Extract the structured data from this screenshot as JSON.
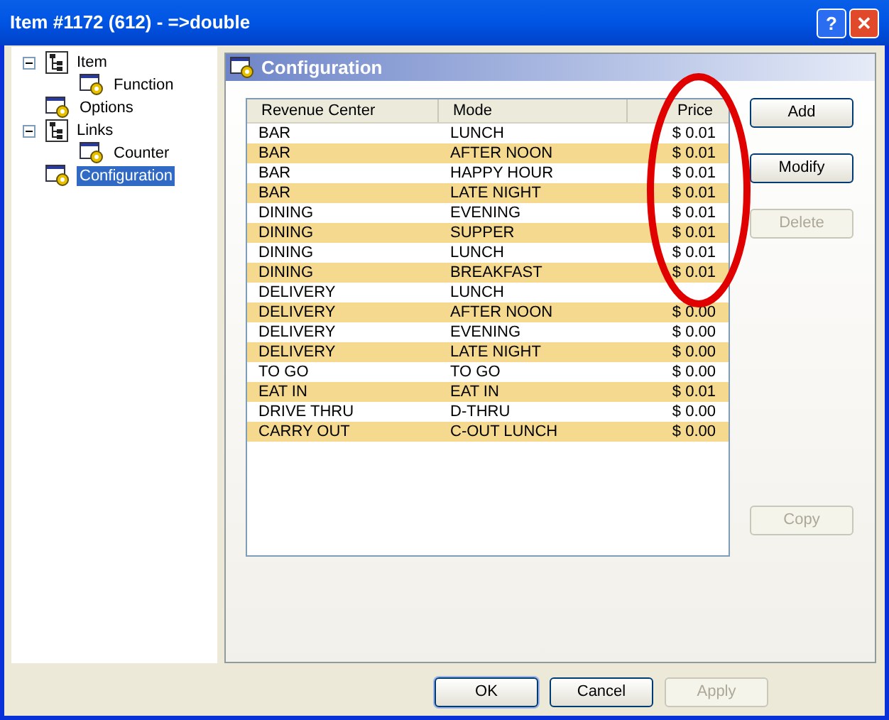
{
  "window": {
    "title": "Item #1172 (612) - =>double"
  },
  "title_buttons": [
    {
      "kind": "help",
      "label": "?"
    },
    {
      "kind": "close",
      "label": "✕"
    }
  ],
  "tree": [
    {
      "label": "Item",
      "kind": "group",
      "expanded": true,
      "selected": false,
      "children": [
        {
          "label": "Function",
          "kind": "page",
          "selected": false
        }
      ]
    },
    {
      "label": "Options",
      "kind": "page",
      "selected": false
    },
    {
      "label": "Links",
      "kind": "group",
      "expanded": true,
      "selected": false,
      "children": [
        {
          "label": "Counter",
          "kind": "page",
          "selected": false
        }
      ]
    },
    {
      "label": "Configuration",
      "kind": "page",
      "selected": true
    }
  ],
  "panel": {
    "title": "Configuration"
  },
  "table": {
    "columns": [
      "Revenue Center",
      "Mode",
      "Price"
    ],
    "rows": [
      {
        "cells": [
          "BAR",
          "LUNCH",
          "$ 0.01"
        ],
        "highlighted": false
      },
      {
        "cells": [
          "BAR",
          "AFTER NOON",
          "$ 0.01"
        ],
        "highlighted": true
      },
      {
        "cells": [
          "BAR",
          "HAPPY HOUR",
          "$ 0.01"
        ],
        "highlighted": false
      },
      {
        "cells": [
          "BAR",
          "LATE NIGHT",
          "$ 0.01"
        ],
        "highlighted": true
      },
      {
        "cells": [
          "DINING",
          "EVENING",
          "$ 0.01"
        ],
        "highlighted": false
      },
      {
        "cells": [
          "DINING",
          "SUPPER",
          "$ 0.01"
        ],
        "highlighted": true
      },
      {
        "cells": [
          "DINING",
          "LUNCH",
          "$ 0.01"
        ],
        "highlighted": false
      },
      {
        "cells": [
          "DINING",
          "BREAKFAST",
          "$ 0.01"
        ],
        "highlighted": true
      },
      {
        "cells": [
          "DELIVERY",
          "LUNCH"
        ],
        "highlighted": false
      },
      {
        "cells": [
          "DELIVERY",
          "AFTER NOON",
          "$ 0.00"
        ],
        "highlighted": true
      },
      {
        "cells": [
          "DELIVERY",
          "EVENING",
          "$ 0.00"
        ],
        "highlighted": false
      },
      {
        "cells": [
          "DELIVERY",
          "LATE NIGHT",
          "$ 0.00"
        ],
        "highlighted": true
      },
      {
        "cells": [
          "TO GO",
          "TO GO",
          "$ 0.00"
        ],
        "highlighted": false
      },
      {
        "cells": [
          "EAT IN",
          "EAT IN",
          "$ 0.01"
        ],
        "highlighted": true
      },
      {
        "cells": [
          "DRIVE THRU",
          "D-THRU",
          "$ 0.00"
        ],
        "highlighted": false
      },
      {
        "cells": [
          "CARRY OUT",
          "C-OUT LUNCH",
          "$ 0.00"
        ],
        "highlighted": true
      }
    ]
  },
  "side_buttons": [
    {
      "label": "Add",
      "disabled": false
    },
    {
      "label": "Modify",
      "disabled": false
    },
    {
      "label": "Delete",
      "disabled": true
    }
  ],
  "copy_button": {
    "label": "Copy",
    "disabled": true
  },
  "dialog_buttons": [
    {
      "label": "OK",
      "disabled": false,
      "default": true
    },
    {
      "label": "Cancel",
      "disabled": false,
      "default": false
    },
    {
      "label": "Apply",
      "disabled": true,
      "default": false
    }
  ],
  "annotation": {
    "kind": "ellipse",
    "color": "#e00000"
  }
}
